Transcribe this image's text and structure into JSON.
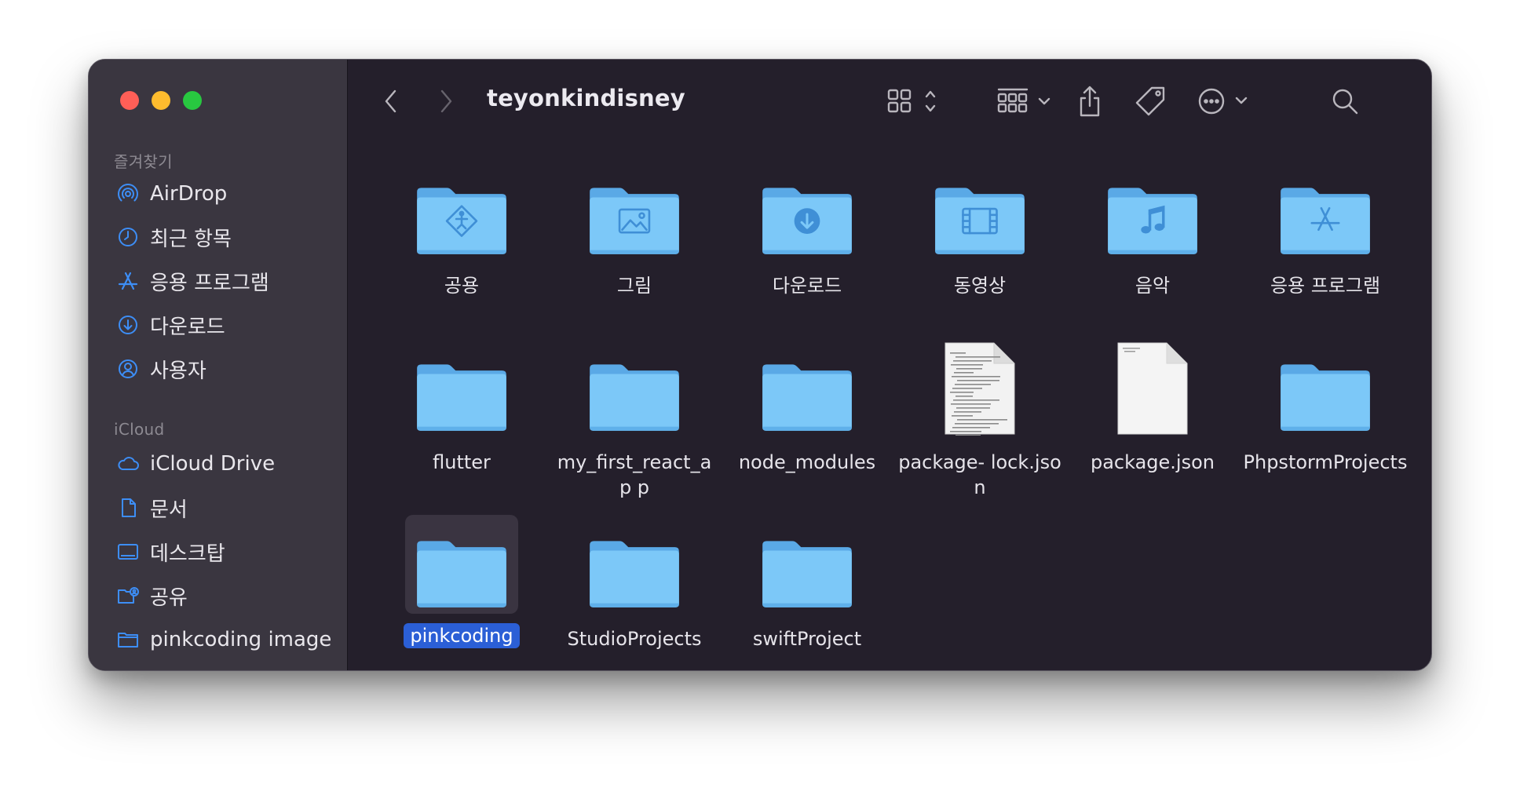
{
  "window": {
    "title": "teyonkindisney"
  },
  "sidebar": {
    "favorites_title": "즐겨찾기",
    "favorites": [
      {
        "label": "AirDrop",
        "icon": "airdrop-icon"
      },
      {
        "label": "최근 항목",
        "icon": "clock-icon"
      },
      {
        "label": "응용 프로그램",
        "icon": "applications-icon"
      },
      {
        "label": "다운로드",
        "icon": "download-icon"
      },
      {
        "label": "사용자",
        "icon": "user-icon"
      }
    ],
    "icloud_title": "iCloud",
    "icloud": [
      {
        "label": "iCloud Drive",
        "icon": "cloud-icon"
      },
      {
        "label": "문서",
        "icon": "document-icon"
      },
      {
        "label": "데스크탑",
        "icon": "desktop-icon"
      },
      {
        "label": "공유",
        "icon": "shared-folder-icon"
      },
      {
        "label": "pinkcoding image",
        "icon": "folder-icon"
      }
    ]
  },
  "items": [
    {
      "label": "공용",
      "kind": "folder",
      "glyph": "public"
    },
    {
      "label": "그림",
      "kind": "folder",
      "glyph": "pictures"
    },
    {
      "label": "다운로드",
      "kind": "folder",
      "glyph": "downloads"
    },
    {
      "label": "동영상",
      "kind": "folder",
      "glyph": "movies"
    },
    {
      "label": "음악",
      "kind": "folder",
      "glyph": "music"
    },
    {
      "label": "응용 프로그램",
      "kind": "folder",
      "glyph": "apps"
    },
    {
      "label": "flutter",
      "kind": "folder"
    },
    {
      "label": "my_first_react_ap p",
      "kind": "folder"
    },
    {
      "label": "node_modules",
      "kind": "folder"
    },
    {
      "label": "package- lock.json",
      "kind": "file-text"
    },
    {
      "label": "package.json",
      "kind": "file-blank"
    },
    {
      "label": "PhpstormProjects",
      "kind": "folder"
    },
    {
      "label": "pinkcoding",
      "kind": "folder",
      "selected": true
    },
    {
      "label": "StudioProjects",
      "kind": "folder"
    },
    {
      "label": "swiftProject",
      "kind": "folder"
    }
  ],
  "colors": {
    "accent": "#2b5fd6",
    "folder": "#7cc8f8",
    "sidebar_icon": "#3d8ef6"
  }
}
